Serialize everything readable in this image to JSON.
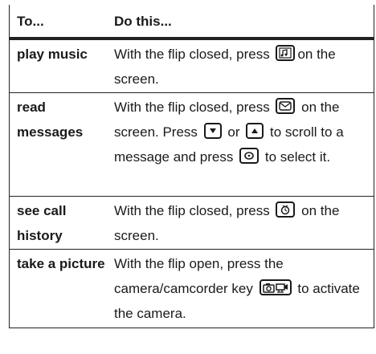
{
  "header": {
    "col1": "To...",
    "col2": "Do this..."
  },
  "rows": [
    {
      "task": "play music",
      "text_before": "With the flip closed, press",
      "icon1": "music-key-icon",
      "text_after": "on the screen."
    },
    {
      "task": "read messages",
      "text_before": "With the flip closed, press",
      "icon1": "message-key-icon",
      "text_mid1": "on the screen. Press",
      "icon2": "down-arrow-key-icon",
      "text_mid2": "or",
      "icon3": "up-arrow-key-icon",
      "text_mid3": "to scroll to a message and press",
      "icon4": "select-key-icon",
      "text_after": "to select it."
    },
    {
      "task": "see call history",
      "text_before": "With the flip closed, press",
      "icon1": "recent-calls-key-icon",
      "text_after": "on the screen."
    },
    {
      "task": "take a picture",
      "text_before": "With the flip open, press the camera/camcorder key",
      "icon1": "camera-camcorder-key-icon",
      "text_after": "to activate the camera."
    }
  ]
}
